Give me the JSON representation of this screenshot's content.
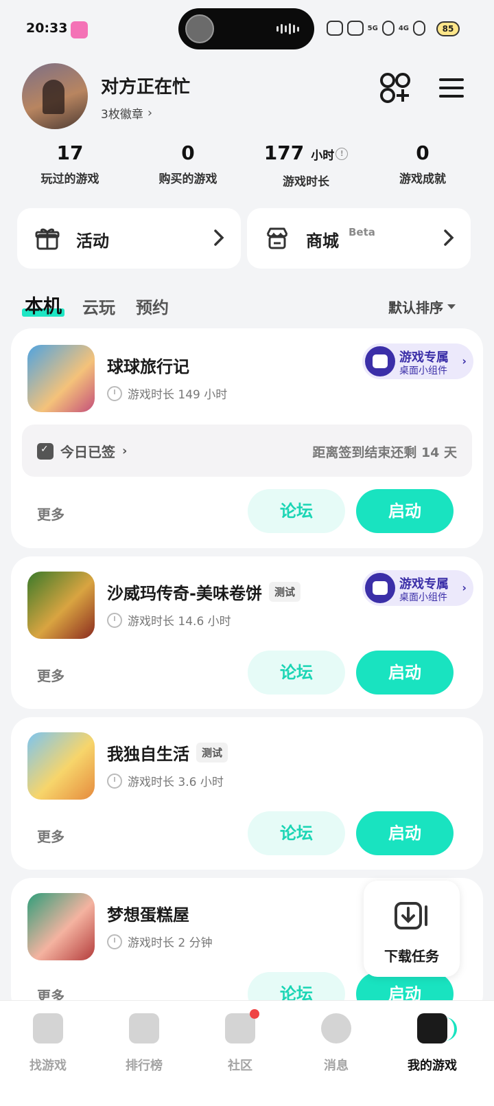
{
  "status_bar": {
    "time": "20:33",
    "net_5g": "5G",
    "net_4g": "4G",
    "battery": "85"
  },
  "profile": {
    "name": "对方正在忙",
    "badges": "3枚徽章"
  },
  "stats": [
    {
      "value": "17",
      "unit": "",
      "label": "玩过的游戏"
    },
    {
      "value": "0",
      "unit": "",
      "label": "购买的游戏"
    },
    {
      "value": "177",
      "unit": "小时",
      "label": "游戏时长"
    },
    {
      "value": "0",
      "unit": "",
      "label": "游戏成就"
    }
  ],
  "quick_cards": {
    "activity": {
      "label": "活动"
    },
    "store": {
      "label": "商城",
      "beta": "Beta"
    }
  },
  "tabs": {
    "local": "本机",
    "cloud": "云玩",
    "reserve": "预约",
    "sort": "默认排序"
  },
  "widget_pill": {
    "title": "游戏专属",
    "subtitle": "桌面小组件"
  },
  "games": [
    {
      "title": "球球旅行记",
      "tag": "",
      "playtime": "游戏时长 149 小时",
      "checkin": {
        "status": "今日已签",
        "remaining": "距离签到结束还剩 14 天"
      },
      "more": "更多",
      "forum": "论坛",
      "launch": "启动"
    },
    {
      "title": "沙威玛传奇-美味卷饼",
      "tag": "测试",
      "playtime": "游戏时长 14.6 小时",
      "more": "更多",
      "forum": "论坛",
      "launch": "启动"
    },
    {
      "title": "我独自生活",
      "tag": "测试",
      "playtime": "游戏时长 3.6 小时",
      "more": "更多",
      "forum": "论坛",
      "launch": "启动"
    },
    {
      "title": "梦想蛋糕屋",
      "tag": "",
      "playtime": "游戏时长 2 分钟",
      "more": "更多",
      "forum": "论坛",
      "launch": "启动"
    }
  ],
  "download": {
    "label": "下载任务"
  },
  "nav": [
    {
      "label": "找游戏"
    },
    {
      "label": "排行榜"
    },
    {
      "label": "社区"
    },
    {
      "label": "消息"
    },
    {
      "label": "我的游戏"
    }
  ],
  "colors": {
    "accent": "#19e3c0",
    "accent_light": "#e6fbf7",
    "widget_purple": "#3b2fa8",
    "background": "#f3f4f6"
  }
}
